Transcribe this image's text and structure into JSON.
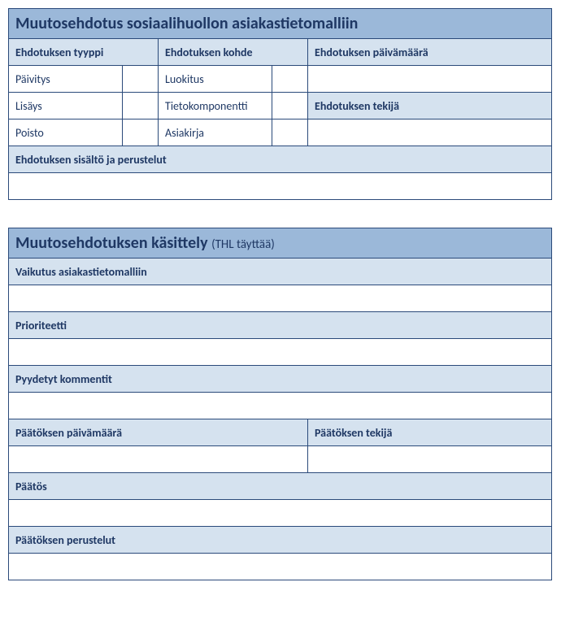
{
  "form1": {
    "title": "Muutosehdotus sosiaalihuollon asiakastietomalliin",
    "col1_header": "Ehdotuksen tyyppi",
    "col2_header": "Ehdotuksen kohde",
    "col3_header": "Ehdotuksen päivämäärä",
    "tyyppi": {
      "r1": "Päivitys",
      "r2": "Lisäys",
      "r3": "Poisto"
    },
    "tyyppi_check": {
      "r1": "",
      "r2": "",
      "r3": ""
    },
    "kohde": {
      "r1": "Luokitus",
      "r2": "Tietokomponentti",
      "r3": "Asiakirja"
    },
    "kohde_check": {
      "r1": "",
      "r2": "",
      "r3": ""
    },
    "paivamaara_value": "",
    "tekija_header": "Ehdotuksen tekijä",
    "tekija_value": "",
    "sisalto_header": "Ehdotuksen sisältö ja perustelut",
    "sisalto_value": ""
  },
  "form2": {
    "title_main": "Muutosehdotuksen käsittely ",
    "title_sub": "(THL täyttää)",
    "vaikutus_header": "Vaikutus asiakastietomalliin",
    "vaikutus_value": "",
    "prioriteetti_header": "Prioriteetti",
    "prioriteetti_value": "",
    "kommentit_header": "Pyydetyt kommentit",
    "kommentit_value": "",
    "paatos_pvm_header": "Päätöksen päivämäärä",
    "paatos_pvm_value": "",
    "paatos_tekija_header": "Päätöksen tekijä",
    "paatos_tekija_value": "",
    "paatos_header": "Päätös",
    "paatos_value": "",
    "perustelut_header": "Päätöksen perustelut",
    "perustelut_value": ""
  }
}
